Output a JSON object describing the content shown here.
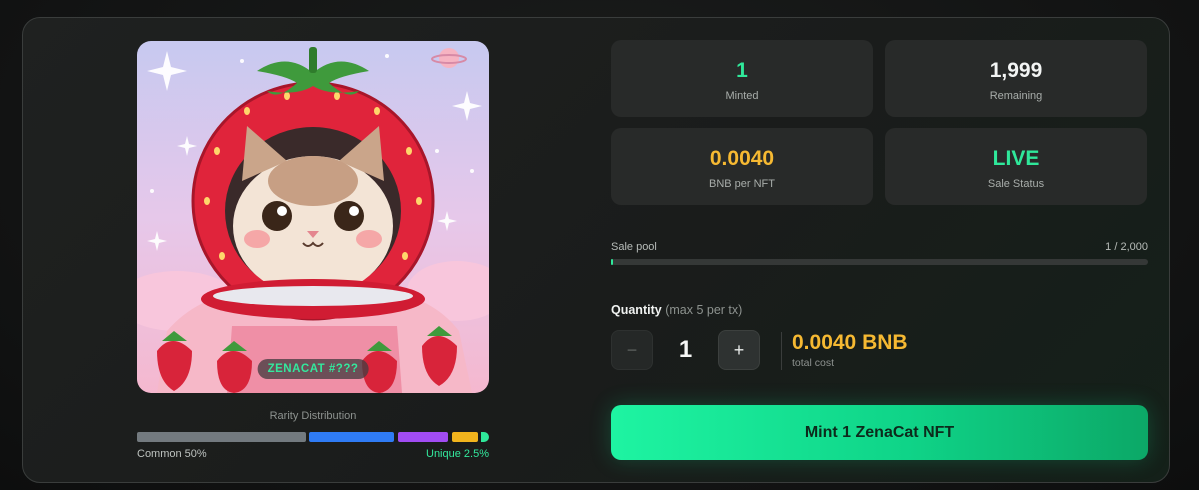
{
  "nft_preview": {
    "badge": "ZENACAT #???"
  },
  "rarity": {
    "label": "Rarity Distribution",
    "left_label": "Common 50%",
    "right_label": "Unique 2.5%",
    "segments": [
      {
        "name": "common",
        "color": "#737a7f"
      },
      {
        "name": "uncommon",
        "color": "#2f7bf4"
      },
      {
        "name": "rare",
        "color": "#a14cf3"
      },
      {
        "name": "epic",
        "color": "#f1b41d"
      },
      {
        "name": "unique",
        "color": "#2fe89a"
      }
    ]
  },
  "stats": {
    "minted": {
      "value": "1",
      "label": "Minted"
    },
    "remaining": {
      "value": "1,999",
      "label": "Remaining"
    },
    "price": {
      "value": "0.0040",
      "label": "BNB per NFT"
    },
    "status": {
      "value": "LIVE",
      "label": "Sale Status"
    }
  },
  "sale_pool": {
    "label": "Sale pool",
    "progress_text": "1 / 2,000",
    "progress_fraction": 0.0005
  },
  "quantity": {
    "label": "Quantity",
    "hint": "(max 5 per tx)",
    "minus": "−",
    "value": "1",
    "plus": "+",
    "total_value": "0.0040 BNB",
    "total_label": "total cost"
  },
  "mint_button": {
    "label": "Mint 1 ZenaCat NFT"
  },
  "colors": {
    "accent_green": "#2fe89a",
    "accent_gold": "#f6b932"
  }
}
